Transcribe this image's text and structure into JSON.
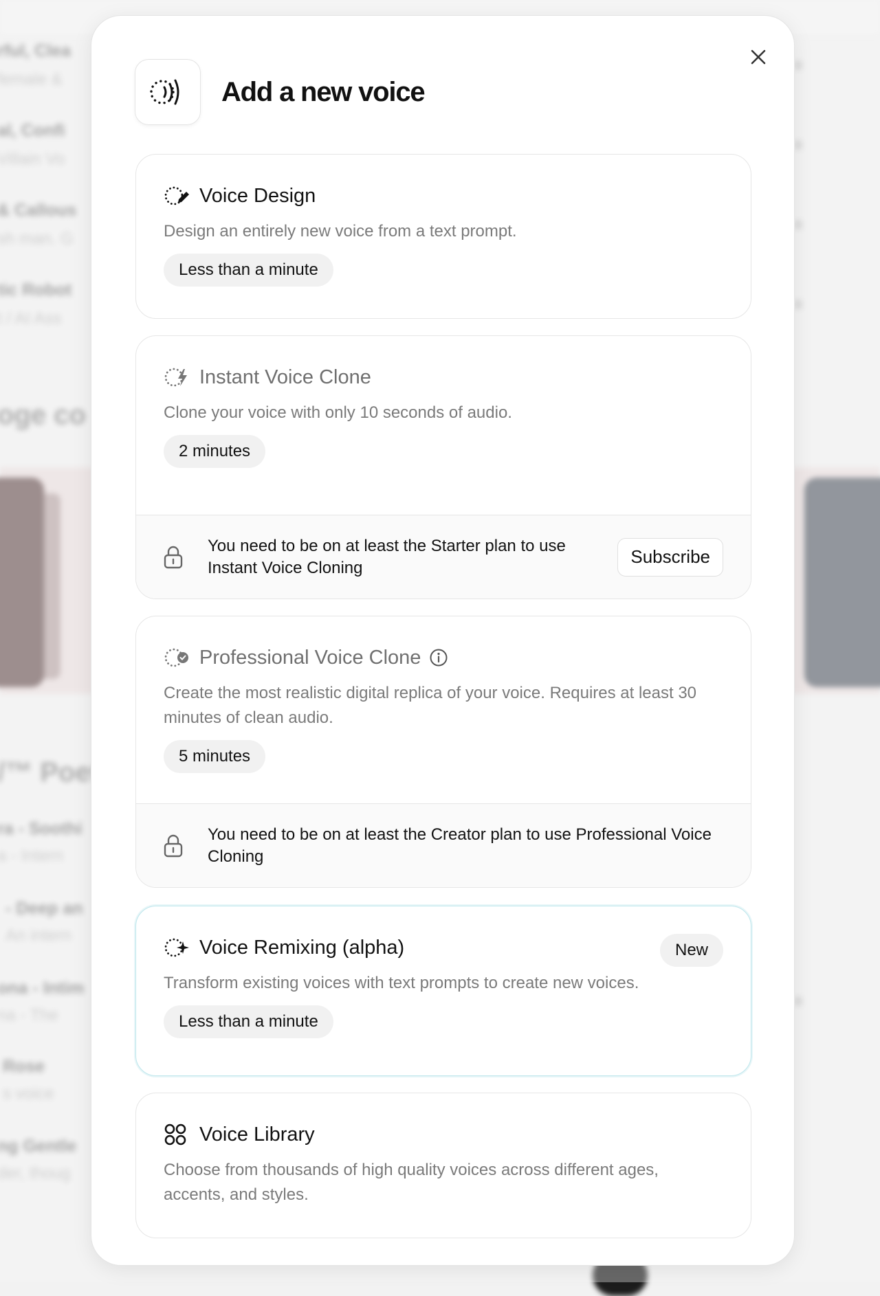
{
  "background": {
    "rows": [
      {
        "title": "rful, Clea",
        "sub": "female &"
      },
      {
        "title": "al, Confi",
        "sub": "Villain Vo"
      },
      {
        "title": "& Callous",
        "sub": "sh man. G"
      },
      {
        "title": "tic Robot",
        "sub": "t / AI Ass"
      }
    ],
    "section_heading_1": "oge co",
    "section_heading_2": "/™ Poeti",
    "rows_2": [
      {
        "title": "ra - Soothi",
        "sub": "a - Intern"
      },
      {
        "title": "- Deep an",
        "sub": "An intern"
      },
      {
        "title": "ona - Intim",
        "sub": "na - The"
      },
      {
        "title": "Rose",
        "sub": "s voice"
      },
      {
        "title": "ng Gentle",
        "sub": "der, thoug"
      }
    ]
  },
  "modal": {
    "title": "Add a new voice",
    "header_icon": "voice-waves-icon",
    "close_icon": "close-icon",
    "cards": {
      "voice_design": {
        "title": "Voice Design",
        "icon": "voice-design-icon",
        "description": "Design an entirely new voice from a text prompt.",
        "time": "Less than a minute"
      },
      "instant_clone": {
        "title": "Instant Voice Clone",
        "icon": "instant-clone-icon",
        "description": "Clone your voice with only 10 seconds of audio.",
        "time": "2 minutes",
        "lock_message": "You need to be on at least the Starter plan to use Instant Voice Cloning",
        "button": "Subscribe"
      },
      "professional_clone": {
        "title": "Professional Voice Clone",
        "icon": "professional-clone-icon",
        "description": "Create the most realistic digital replica of your voice. Requires at least 30 minutes of clean audio.",
        "time": "5 minutes",
        "lock_message": "You need to be on at least the Creator plan to use Professional Voice Cloning"
      },
      "remixing": {
        "title": "Voice Remixing (alpha)",
        "icon": "voice-remix-icon",
        "badge": "New",
        "description": "Transform existing voices with text prompts to create new voices.",
        "time": "Less than a minute"
      },
      "library": {
        "title": "Voice Library",
        "icon": "library-grid-icon",
        "description": "Choose from thousands of high quality voices across different ages, accents, and styles."
      }
    }
  },
  "colors": {
    "highlight_border": "#bde6ec",
    "card_border": "#e6e6e6",
    "muted_text": "#7a7a7a"
  }
}
